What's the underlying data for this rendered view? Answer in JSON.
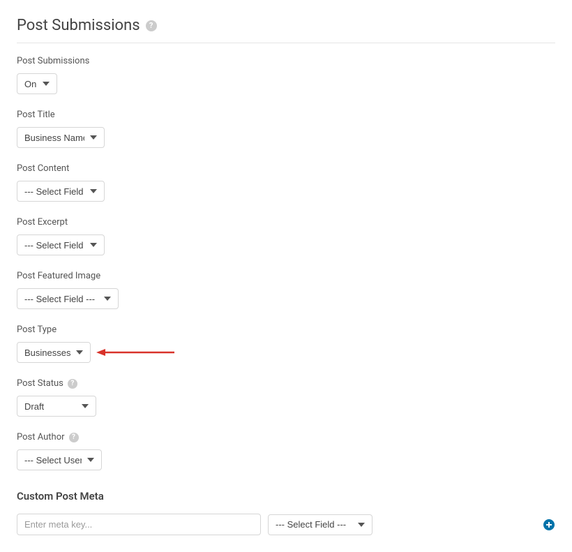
{
  "header": {
    "title": "Post Submissions"
  },
  "fields": {
    "postSubmissions": {
      "label": "Post Submissions",
      "value": "On"
    },
    "postTitle": {
      "label": "Post Title",
      "value": "Business Name"
    },
    "postContent": {
      "label": "Post Content",
      "value": "--- Select Field ---"
    },
    "postExcerpt": {
      "label": "Post Excerpt",
      "value": "--- Select Field ---"
    },
    "postFeaturedImage": {
      "label": "Post Featured Image",
      "value": "--- Select Field ---"
    },
    "postType": {
      "label": "Post Type",
      "value": "Businesses"
    },
    "postStatus": {
      "label": "Post Status",
      "value": "Draft"
    },
    "postAuthor": {
      "label": "Post Author",
      "value": "--- Select User ---"
    }
  },
  "customMeta": {
    "title": "Custom Post Meta",
    "keyPlaceholder": "Enter meta key...",
    "fieldValue": "--- Select Field ---"
  },
  "colors": {
    "addIcon": "#0073aa",
    "arrowRed": "#d8322a"
  }
}
